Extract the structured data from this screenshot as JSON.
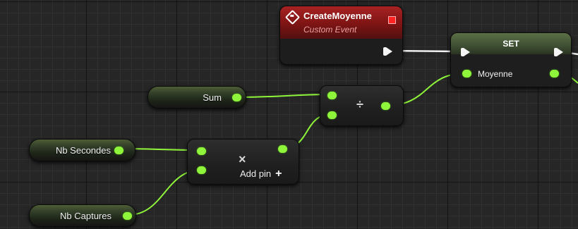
{
  "event_node": {
    "title": "CreateMoyenne",
    "subtitle": "Custom Event"
  },
  "set_node": {
    "title": "SET",
    "input_label": "Moyenne"
  },
  "variables": {
    "sum": "Sum",
    "nb_secondes": "Nb Secondes",
    "nb_captures": "Nb Captures"
  },
  "divide_node": {
    "operator": "÷"
  },
  "multiply_node": {
    "operator": "×",
    "add_pin_label": "Add pin"
  },
  "colors": {
    "wire_float": "#8ef53a",
    "wire_exec": "#f0f0f0",
    "event_header": "#a82222",
    "set_header": "#5b7047"
  },
  "icons": {
    "event": "custom-event-diamond-icon",
    "exec": "exec-pin-arrow-icon",
    "add": "plus-icon"
  }
}
